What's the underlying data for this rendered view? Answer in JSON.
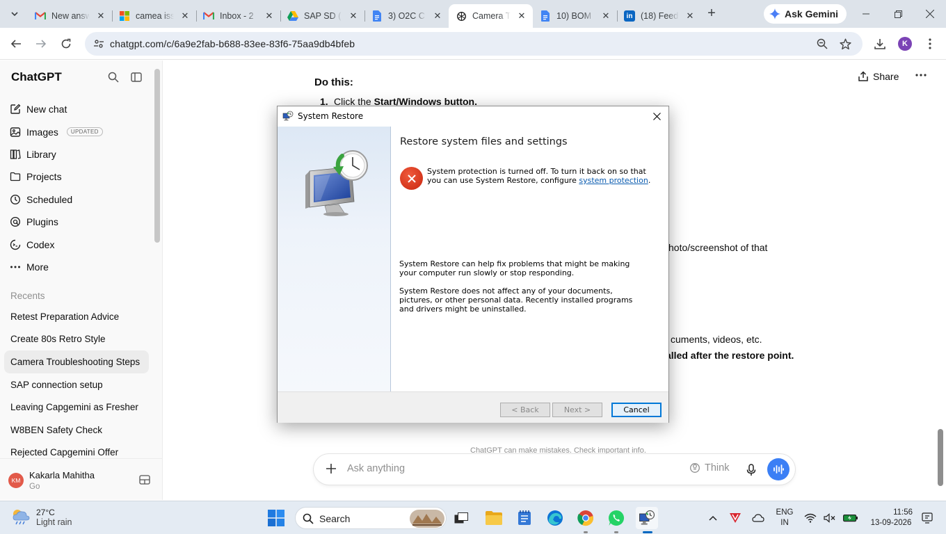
{
  "browser": {
    "tabs": [
      {
        "title": "New answ",
        "favicon": "gmail-icon",
        "color": "#ea4335"
      },
      {
        "title": "camea iss",
        "favicon": "microsoft-icon",
        "color": "#f25022"
      },
      {
        "title": "Inbox - 2",
        "favicon": "gmail-icon",
        "color": "#ea4335"
      },
      {
        "title": "SAP SD (",
        "favicon": "drive-icon",
        "color": "#0f9d58"
      },
      {
        "title": "3) O2C C",
        "favicon": "docs-icon",
        "color": "#4285f4"
      },
      {
        "title": "Camera T",
        "favicon": "chatgpt-icon",
        "color": "#000000",
        "active": true
      },
      {
        "title": "10) BOM",
        "favicon": "docs-icon",
        "color": "#4285f4"
      },
      {
        "title": "(18) Feed",
        "favicon": "linkedin-icon",
        "color": "#0a66c2"
      }
    ],
    "gemini_label": "Ask Gemini",
    "url": "chatgpt.com/c/6a9e2fab-b688-83ee-83f6-75aa9db4bfeb",
    "profile_initial": "K"
  },
  "sidebar": {
    "brand": "ChatGPT",
    "nav": [
      {
        "label": "New chat",
        "icon": "edit-icon"
      },
      {
        "label": "Images",
        "icon": "images-icon",
        "badge": "UPDATED"
      },
      {
        "label": "Library",
        "icon": "library-icon"
      },
      {
        "label": "Projects",
        "icon": "folder-icon"
      },
      {
        "label": "Scheduled",
        "icon": "clock-icon"
      },
      {
        "label": "Plugins",
        "icon": "plugins-icon"
      },
      {
        "label": "Codex",
        "icon": "codex-icon"
      },
      {
        "label": "More",
        "icon": "more-icon"
      }
    ],
    "recents_label": "Recents",
    "recents": [
      "Retest Preparation Advice",
      "Create 80s Retro Style",
      "Camera Troubleshooting Steps",
      "SAP connection setup",
      "Leaving Capgemini as Fresher",
      "W8BEN Safety Check",
      "Rejected Capgemini Offer"
    ],
    "user": {
      "initials": "KM",
      "name": "Kakarla Mahitha",
      "plan": "Go"
    }
  },
  "main": {
    "share_label": "Share",
    "heading": "Do this:",
    "step1_prefix": "1.",
    "step1_text": "Click the ",
    "step1_bold": "Start/Windows button.",
    "frag_photo": "hoto/screenshot of that",
    "frag_docs": "cuments, videos, etc.",
    "frag_installed": "alled after the restore point.",
    "disclaimer": "ChatGPT can make mistakes. Check important info.",
    "composer_placeholder": "Ask anything",
    "think_label": "Think"
  },
  "dialog": {
    "title": "System Restore",
    "heading": "Restore system files and settings",
    "error_text_1": "System protection is turned off. To turn it back on so that you can use System Restore, configure ",
    "error_link": "system protection",
    "error_text_2": ".",
    "para1": "System Restore can help fix problems that might be making your computer run slowly or stop responding.",
    "para2": "System Restore does not affect any of your documents, pictures, or other personal data. Recently installed programs and drivers might be uninstalled.",
    "back_label": "< Back",
    "next_label": "Next >",
    "cancel_label": "Cancel"
  },
  "taskbar": {
    "temperature": "27°C",
    "weather": "Light rain",
    "search_label": "Search",
    "lang_1": "ENG",
    "lang_2": "IN",
    "time": "11:56",
    "date": "13-09-2026"
  }
}
